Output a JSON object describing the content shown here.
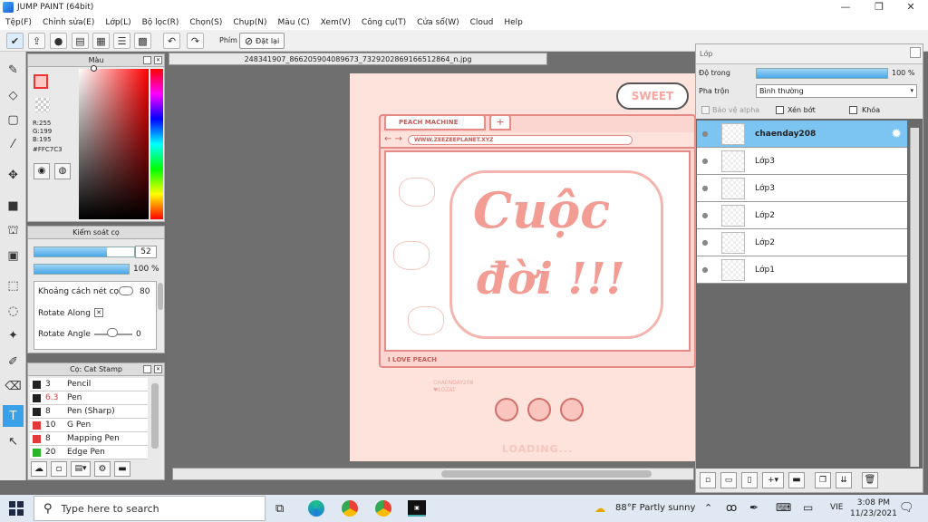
{
  "window": {
    "title": "JUMP PAINT (64bit)",
    "minimize": "—",
    "maximize": "❐",
    "close": "✕"
  },
  "menu": [
    "Tệp(F)",
    "Chỉnh sửa(E)",
    "Lớp(L)",
    "Bộ lọc(R)",
    "Chọn(S)",
    "Chụp(N)",
    "Màu (C)",
    "Xem(V)",
    "Công cụ(T)",
    "Cửa sổ(W)",
    "Cloud",
    "Help"
  ],
  "toolbar": {
    "phim_label": "Phím",
    "reset_label": "Đặt lại"
  },
  "color_panel": {
    "title": "Màu",
    "r": "R:255",
    "g": "G:199",
    "b": "B:195",
    "hex": "#FFC7C3",
    "primary_color": "#ffc7c3"
  },
  "brush_control": {
    "title": "Kiểm soát cọ",
    "size_value": "52",
    "size_fraction": 0.73,
    "opacity_value": "100 %",
    "opacity_fraction": 1.0,
    "spacing_label": "Khoảng cách nét cọ",
    "spacing_value": "80",
    "rotate_along_label": "Rotate Along",
    "rotate_angle_label": "Rotate Angle",
    "rotate_angle_value": "0"
  },
  "brush_list": {
    "title": "Cọ: Cat Stamp",
    "items": [
      {
        "size": "3",
        "name": "Pencil",
        "color": "#222222"
      },
      {
        "size": "6.3",
        "name": "Pen",
        "color": "#222222",
        "size_color": "#e23a3a"
      },
      {
        "size": "8",
        "name": "Pen (Sharp)",
        "color": "#222222"
      },
      {
        "size": "10",
        "name": "G Pen",
        "color": "#e23a3a"
      },
      {
        "size": "8",
        "name": "Mapping Pen",
        "color": "#e23a3a"
      },
      {
        "size": "20",
        "name": "Edge Pen",
        "color": "#2ab52a"
      }
    ]
  },
  "document": {
    "tab_title": "248341907_866205904089673_7329202869166512864_n.jpg"
  },
  "artwork": {
    "browser_tab": "PEACH MACHINE",
    "url": "WWW.ZEEZEEPLANET.XYZ",
    "sweet": "SWEET",
    "line1": "Cuộc",
    "line2": "đời !!!",
    "footer": "I LOVE PEACH",
    "watermark": "CHAENDAY208 ♥LOZAT",
    "loading": "LOADING..."
  },
  "layers_panel": {
    "title": "Lớp",
    "opacity_label": "Độ trong",
    "opacity_value": "100 %",
    "opacity_fraction": 1.0,
    "blend_label": "Pha trộn",
    "blend_value": "Bình thường",
    "protect_alpha": "Bảo vệ alpha",
    "clip": "Xén bớt",
    "lock": "Khóa",
    "layers": [
      {
        "name": "chaenday208",
        "selected": true
      },
      {
        "name": "Lớp3",
        "selected": false
      },
      {
        "name": "Lớp3",
        "selected": false
      },
      {
        "name": "Lớp2",
        "selected": false
      },
      {
        "name": "Lớp2",
        "selected": false
      },
      {
        "name": "Lớp1",
        "selected": false
      }
    ]
  },
  "taskbar": {
    "search_placeholder": "Type here to search",
    "weather": "88°F  Partly sunny",
    "lang": "VIE",
    "time": "3:08 PM",
    "date": "11/23/2021"
  }
}
